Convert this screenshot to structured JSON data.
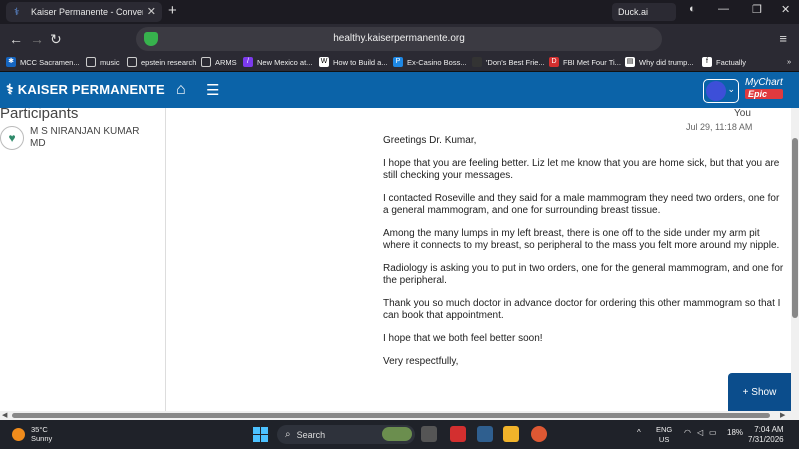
{
  "browser": {
    "tab_title": "Kaiser Permanente - Conversa",
    "duck_label": "Duck.ai",
    "url": "healthy.kaiserpermanente.org"
  },
  "bookmarks": [
    {
      "label": "MCC Sacramen...",
      "icon": "mcc-icon"
    },
    {
      "label": "music",
      "icon": "folder-icon"
    },
    {
      "label": "epstein research",
      "icon": "folder-icon"
    },
    {
      "label": "ARMS",
      "icon": "folder-icon"
    },
    {
      "label": "New Mexico at...",
      "icon": "purple-icon"
    },
    {
      "label": "How to Build a...",
      "icon": "w-icon"
    },
    {
      "label": "Ex-Casino Boss...",
      "icon": "p-icon"
    },
    {
      "label": "'Don's Best Frie...",
      "icon": "dark-icon"
    },
    {
      "label": "FBI Met Four Ti...",
      "icon": "db-icon"
    },
    {
      "label": "Why did trump...",
      "icon": "doc-icon"
    },
    {
      "label": "Factually",
      "icon": "f-icon"
    }
  ],
  "header": {
    "brand": "KAISER PERMANENTE",
    "mychart": "MyChart",
    "epic": "Epic"
  },
  "sidebar": {
    "heading": "Participants",
    "participant_line1": "M S NIRANJAN KUMAR",
    "participant_line2": "MD"
  },
  "message": {
    "sender": "You",
    "timestamp": "Jul 29, 11:18 AM",
    "paragraphs": [
      "Greetings Dr. Kumar,",
      "I hope that you are feeling better. Liz let me know that you are home sick, but that you are still checking your messages.",
      "I contacted Roseville and they said for a male mammogram they need two orders, one for a general mammogram, and one for surrounding breast tissue.",
      "Among the many lumps in my left breast, there is one off to the side under my arm pit where it connects to my breast, so peripheral to the mass you felt more around my nipple.",
      "Radiology is asking you to put in two orders, one for the general mammogram, and one for the peripheral.",
      "Thank you so much doctor in advance doctor for ordering this other mammogram so that I can book that appointment.",
      "I hope that we both feel better soon!",
      "Very respectfully,"
    ]
  },
  "show_button": "+ Show",
  "taskbar": {
    "temp": "35°C",
    "condition": "Sunny",
    "search": "Search",
    "lang1": "ENG",
    "lang2": "US",
    "battery": "18%",
    "time": "7:04 AM",
    "date": "7/31/2026"
  }
}
